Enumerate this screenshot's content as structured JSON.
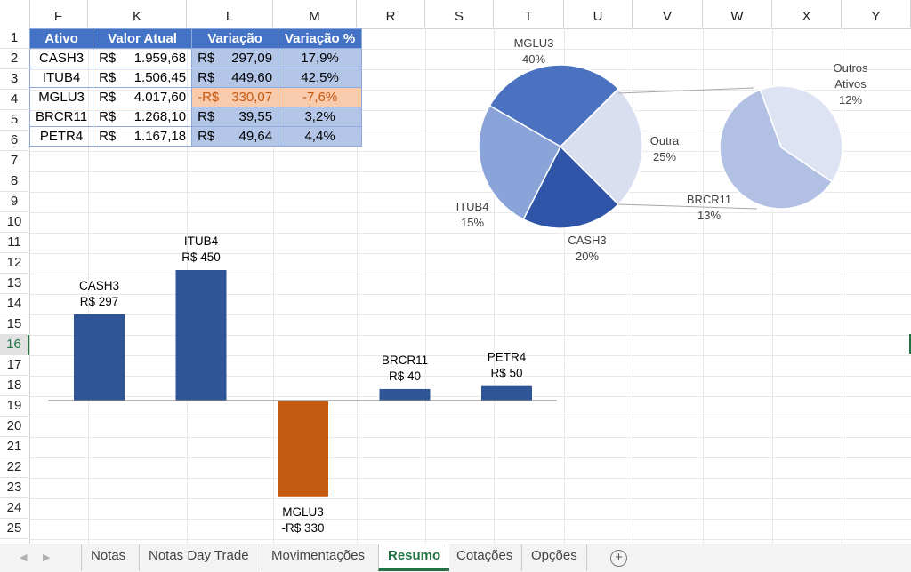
{
  "columns": [
    "F",
    "K",
    "L",
    "M",
    "R",
    "S",
    "T",
    "U",
    "V",
    "W",
    "X",
    "Y"
  ],
  "rows": [
    "1",
    "2",
    "3",
    "4",
    "5",
    "6",
    "7",
    "8",
    "9",
    "10",
    "11",
    "12",
    "13",
    "14",
    "15",
    "16",
    "17",
    "18",
    "19",
    "20",
    "21",
    "22",
    "23",
    "24",
    "25"
  ],
  "active_row": "16",
  "table": {
    "headers": [
      "Ativo",
      "Valor Atual",
      "Variação",
      "Variação %"
    ],
    "rows": [
      {
        "ativo": "CASH3",
        "cur": "R$",
        "valor": "1.959,68",
        "var_cur": "R$",
        "var": "297,09",
        "pct": "17,9%",
        "neg": false
      },
      {
        "ativo": "ITUB4",
        "cur": "R$",
        "valor": "1.506,45",
        "var_cur": "R$",
        "var": "449,60",
        "pct": "42,5%",
        "neg": false
      },
      {
        "ativo": "MGLU3",
        "cur": "R$",
        "valor": "4.017,60",
        "var_cur": "-R$",
        "var": "330,07",
        "pct": "-7,6%",
        "neg": true
      },
      {
        "ativo": "BRCR11",
        "cur": "R$",
        "valor": "1.268,10",
        "var_cur": "R$",
        "var": "39,55",
        "pct": "3,2%",
        "neg": false
      },
      {
        "ativo": "PETR4",
        "cur": "R$",
        "valor": "1.167,18",
        "var_cur": "R$",
        "var": "49,64",
        "pct": "4,4%",
        "neg": false
      }
    ]
  },
  "chart_data": [
    {
      "type": "bar",
      "categories": [
        "CASH3",
        "ITUB4",
        "MGLU3",
        "BRCR11",
        "PETR4"
      ],
      "values": [
        297,
        450,
        -330,
        40,
        50
      ],
      "labels": [
        "R$ 297",
        "R$ 450",
        "-R$ 330",
        "R$ 40",
        "R$ 50"
      ],
      "colors": [
        "#2f5597",
        "#2f5597",
        "#c55a11",
        "#2f5597",
        "#2f5597"
      ],
      "ylim": [
        -330,
        450
      ],
      "grid": false
    },
    {
      "type": "pie",
      "subtype": "pie-of-pie",
      "main": [
        {
          "name": "MGLU3",
          "label": "40%",
          "value": 40,
          "color": "#4a72c0"
        },
        {
          "name": "Outra",
          "label": "25%",
          "value": 25,
          "color": "#d9dff0"
        },
        {
          "name": "CASH3",
          "label": "20%",
          "value": 20,
          "color": "#2e55a8"
        },
        {
          "name": "ITUB4",
          "label": "15%",
          "value": 15,
          "color": "#8aa3d8"
        }
      ],
      "secondary": [
        {
          "name": "Outros Ativos",
          "label": "12%",
          "value": 12,
          "color": "#dde3f2"
        },
        {
          "name": "BRCR11",
          "label": "13%",
          "value": 13,
          "color": "#b1c0e3"
        }
      ]
    }
  ],
  "tabs": [
    "Notas",
    "Notas Day Trade",
    "Movimentações",
    "Resumo",
    "Cotações",
    "Opções"
  ],
  "active_tab": "Resumo",
  "add_sheet_label": "+"
}
